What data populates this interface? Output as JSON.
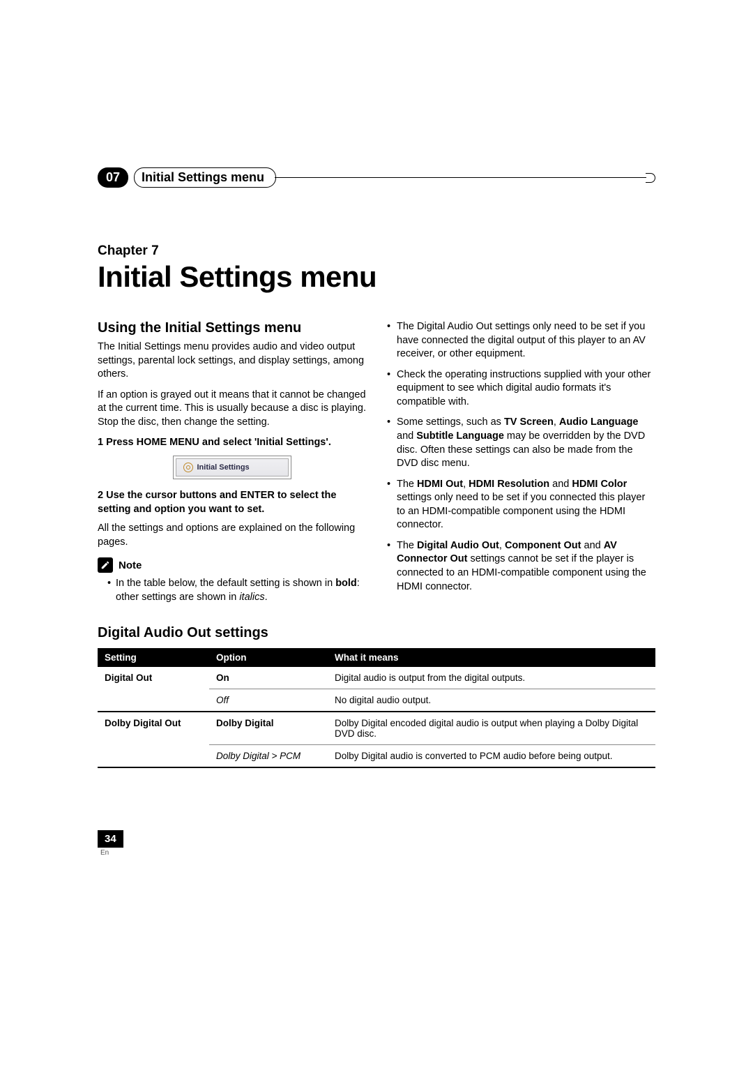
{
  "header": {
    "chapter_number": "07",
    "running_title": "Initial Settings menu"
  },
  "chapter": {
    "label": "Chapter 7",
    "title": "Initial Settings menu"
  },
  "left": {
    "section_title": "Using the Initial Settings menu",
    "intro_p1": "The Initial Settings menu provides audio and video output settings, parental lock settings, and display settings, among others.",
    "intro_p2": "If an option is grayed out it means that it cannot be changed at the current time. This is usually because a disc is playing. Stop the disc, then change the setting.",
    "step1": "1   Press HOME MENU and select 'Initial Settings'.",
    "screenshot_label": "Initial Settings",
    "step2": "2   Use the cursor buttons and ENTER to select the setting and option you want to set.",
    "after_step2": "All the settings and options are explained on the following pages.",
    "note_label": "Note",
    "note_pre": "In the table below, the default setting is shown in ",
    "note_bold_word": "bold",
    "note_mid": ": other settings are shown in ",
    "note_italic_word": "italics",
    "note_post": "."
  },
  "right": {
    "b1": "The Digital Audio Out settings only need to be set if you have connected the digital output of this player to an AV receiver, or other equipment.",
    "b2": "Check the operating instructions supplied with your other equipment to see which digital audio formats it's compatible with.",
    "b3_pre": "Some settings, such as ",
    "b3_s1": "TV Screen",
    "b3_c1": ", ",
    "b3_s2": "Audio Language",
    "b3_c2": " and ",
    "b3_s3": "Subtitle Language",
    "b3_post": " may be overridden by the DVD disc. Often these settings can also be made from the DVD disc menu.",
    "b4_pre": "The ",
    "b4_s1": "HDMI Out",
    "b4_c1": ", ",
    "b4_s2": "HDMI Resolution",
    "b4_c2": " and ",
    "b4_s3": "HDMI Color",
    "b4_post": " settings only need to be set if you connected this player to an HDMI-compatible component using the HDMI connector.",
    "b5_pre": "The ",
    "b5_s1": "Digital Audio Out",
    "b5_c1": ", ",
    "b5_s2": "Component Out",
    "b5_c2": " and ",
    "b5_s3": "AV Connector Out",
    "b5_post": " settings cannot be set if the player is connected to an HDMI-compatible component using the HDMI connector."
  },
  "table": {
    "title": "Digital Audio Out settings",
    "head": {
      "c1": "Setting",
      "c2": "Option",
      "c3": "What it means"
    },
    "rows": [
      {
        "setting": "Digital Out",
        "option": "On",
        "option_style": "bold",
        "meaning": "Digital audio is output from the digital outputs."
      },
      {
        "setting": "",
        "option": "Off",
        "option_style": "italic",
        "meaning": "No digital audio output."
      },
      {
        "setting": "Dolby Digital Out",
        "option": "Dolby Digital",
        "option_style": "bold",
        "meaning": "Dolby Digital encoded digital audio is output when playing a Dolby Digital DVD disc."
      },
      {
        "setting": "",
        "option": "Dolby Digital > PCM",
        "option_style": "italic",
        "meaning": "Dolby Digital audio is converted to PCM audio before being output."
      }
    ]
  },
  "footer": {
    "page_number": "34",
    "lang": "En"
  }
}
